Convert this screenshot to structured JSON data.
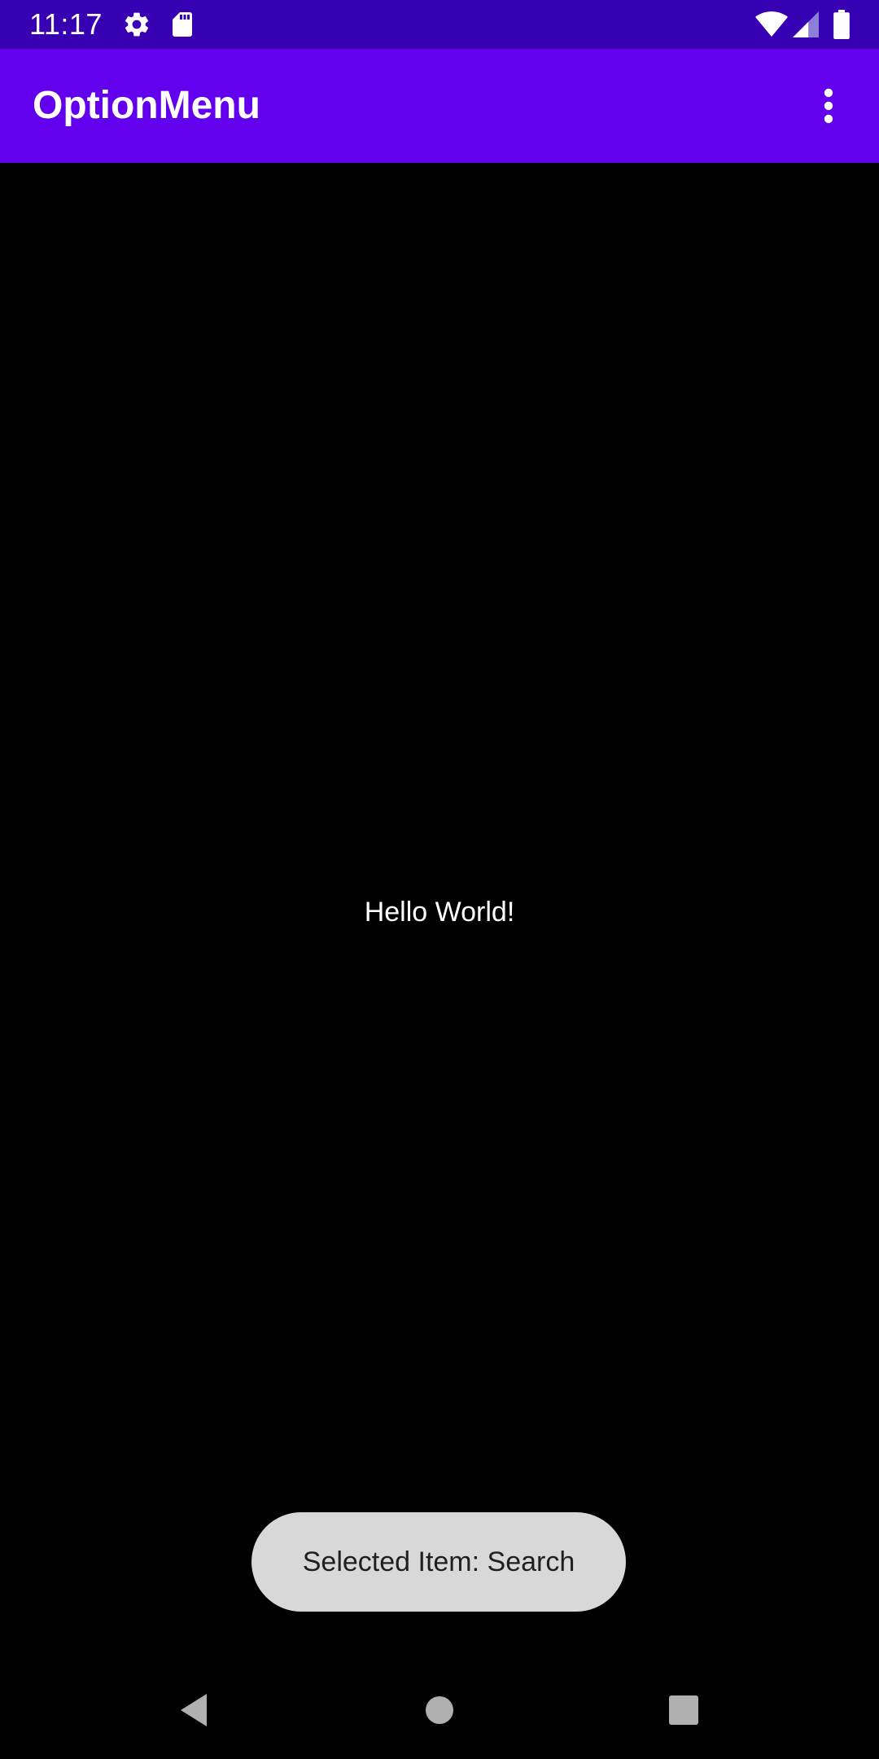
{
  "status_bar": {
    "time": "11:17",
    "icons_left": [
      "settings-icon",
      "sd-card-icon"
    ],
    "icons_right": [
      "wifi-icon",
      "cellular-signal-icon",
      "battery-icon"
    ],
    "background": "#3700b3"
  },
  "app_bar": {
    "title": "OptionMenu",
    "overflow_icon": "more-vert-icon",
    "background": "#6200ee"
  },
  "main": {
    "text": "Hello World!",
    "background": "#000000"
  },
  "toast": {
    "text": "Selected Item: Search",
    "background": "#d8d8d8"
  },
  "nav_bar": {
    "buttons": [
      "back-icon",
      "home-icon",
      "recents-icon"
    ]
  }
}
